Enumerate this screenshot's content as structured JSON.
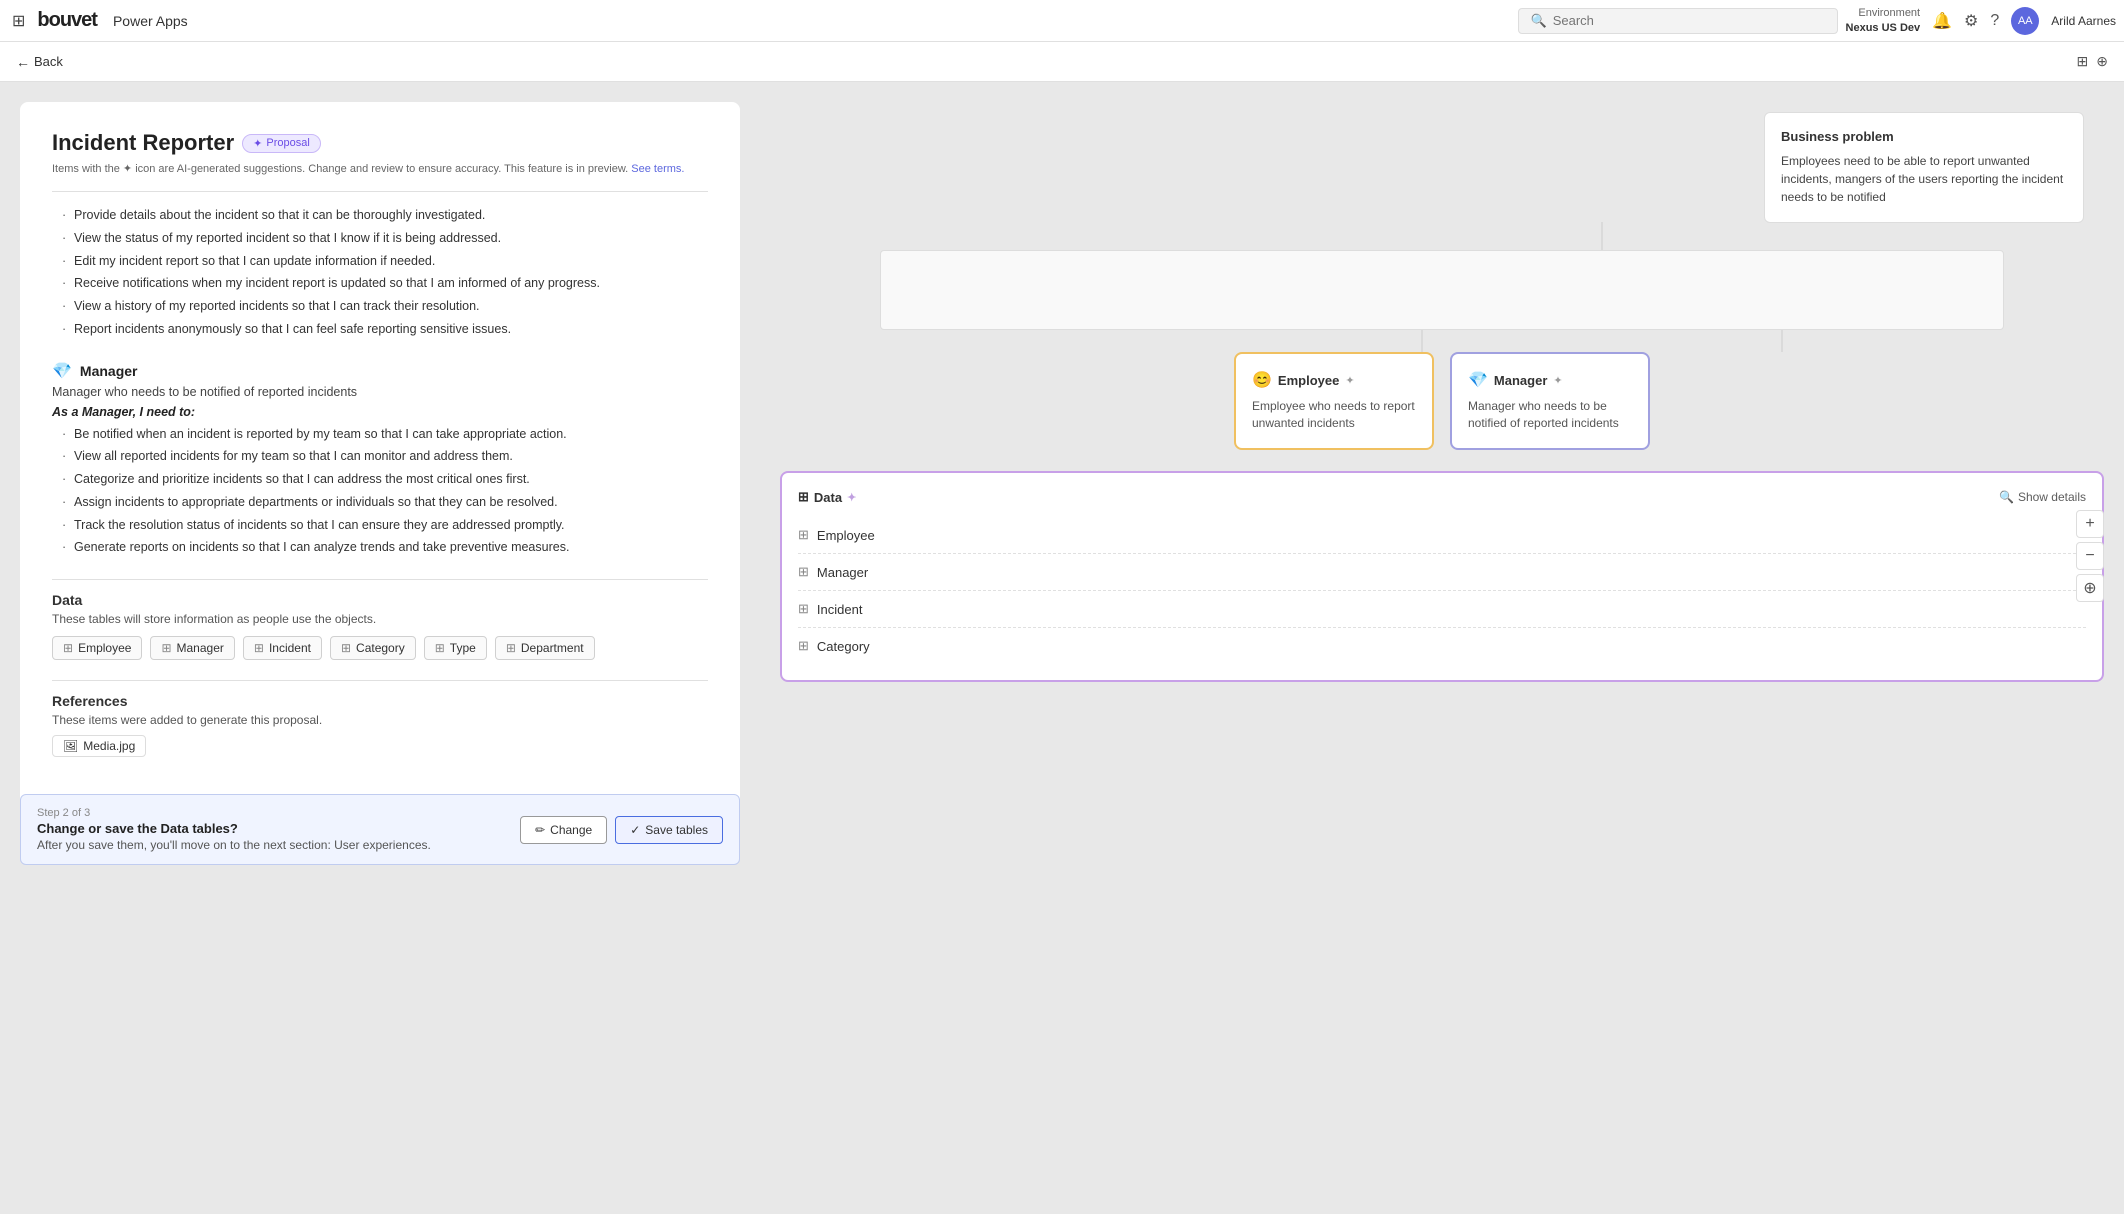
{
  "topbar": {
    "grid_icon": "⊞",
    "logo": "bouvet",
    "app_name": "Power Apps",
    "search_placeholder": "Search",
    "env_label": "Environment",
    "env_name": "Nexus US Dev",
    "user_name": "Arild Aarnes"
  },
  "subbar": {
    "back_label": "Back"
  },
  "left_panel": {
    "card_title": "Incident Reporter",
    "proposal_badge": "Proposal",
    "ai_notice": "Items with the ✦ icon are AI-generated suggestions. Change and review to ensure accuracy. This feature is in preview.",
    "ai_notice_link": "See terms.",
    "bullet_items": [
      "Provide details about the incident so that it can be thoroughly investigated.",
      "View the status of my reported incident so that I know if it is being addressed.",
      "Edit my incident report so that I can update information if needed.",
      "Receive notifications when my incident report is updated so that I am informed of any progress.",
      "View a history of my reported incidents so that I can track their resolution.",
      "Report incidents anonymously so that I can feel safe reporting sensitive issues."
    ],
    "manager_section": {
      "icon": "💎",
      "title": "Manager",
      "subtitle": "Manager who needs to be notified of reported incidents",
      "as_label": "As a Manager, I need to:",
      "bullets": [
        "Be notified when an incident is reported by my team so that I can take appropriate action.",
        "View all reported incidents for my team so that I can monitor and address them.",
        "Categorize and prioritize incidents so that I can address the most critical ones first.",
        "Assign incidents to appropriate departments or individuals so that they can be resolved.",
        "Track the resolution status of incidents so that I can ensure they are addressed promptly.",
        "Generate reports on incidents so that I can analyze trends and take preventive measures."
      ]
    },
    "data_section": {
      "title": "Data",
      "subtitle": "These tables will store information as people use the objects.",
      "tables": [
        {
          "name": "Employee"
        },
        {
          "name": "Manager"
        },
        {
          "name": "Incident"
        },
        {
          "name": "Category"
        },
        {
          "name": "Type"
        },
        {
          "name": "Department"
        }
      ]
    },
    "references_section": {
      "title": "References",
      "subtitle": "These items were added to generate this proposal.",
      "file": "Media.jpg"
    },
    "action_bar": {
      "step": "Step 2 of 3",
      "title": "Change or save the Data tables?",
      "subtitle": "After you save them, you'll move on to the next section: User experiences.",
      "change_label": "Change",
      "save_label": "Save tables"
    }
  },
  "right_panel": {
    "business_problem": {
      "title": "Business problem",
      "text": "Employees need to be able to report unwanted incidents, mangers of the users reporting the incident needs to be notified"
    },
    "employee_persona": {
      "icon": "😊",
      "name": "Employee",
      "ai_indicator": "✦",
      "description": "Employee who needs to report unwanted incidents"
    },
    "manager_persona": {
      "icon": "💎",
      "name": "Manager",
      "ai_indicator": "✦",
      "description": "Manager who needs to be notified of reported incidents"
    },
    "data_card": {
      "title": "Data",
      "ai_indicator": "✦",
      "show_details_label": "Show details",
      "tables": [
        {
          "name": "Employee"
        },
        {
          "name": "Manager"
        },
        {
          "name": "Incident"
        },
        {
          "name": "Category"
        }
      ]
    },
    "zoom_in": "+",
    "zoom_out": "−",
    "zoom_target": "⊕"
  }
}
